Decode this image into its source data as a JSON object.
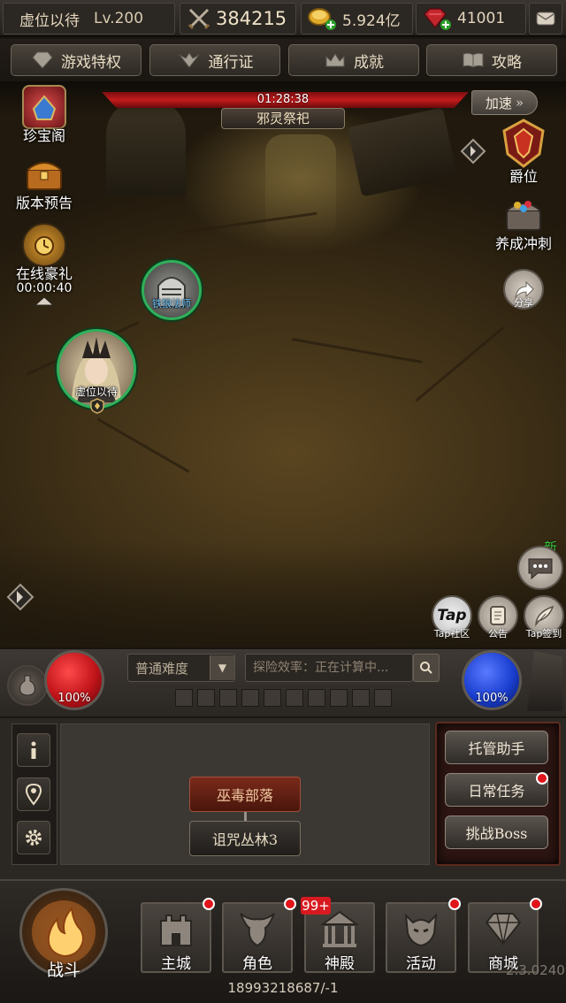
{
  "topbar": {
    "player_name": "虚位以待",
    "level": "Lv.200",
    "power": "384215",
    "gold": "5.924亿",
    "gems": "41001"
  },
  "nav": [
    "游戏特权",
    "通行证",
    "成就",
    "攻略"
  ],
  "scene": {
    "boss_timer": "01:28:38",
    "boss_title": "邪灵祭祀",
    "speed_label": "加速",
    "left_icons": [
      {
        "label": "珍宝阁"
      },
      {
        "label": "版本预告"
      },
      {
        "label": "在线豪礼",
        "timer": "00:00:40"
      }
    ],
    "right_icons": [
      {
        "label": "爵位"
      },
      {
        "label": "养成冲刺"
      }
    ],
    "share_label": "分享",
    "new_badge": "新",
    "tap_buttons": [
      {
        "glyph": "Tap",
        "label": "Tap社区"
      },
      {
        "label": "公告"
      },
      {
        "label": "Tap签到"
      }
    ],
    "pet_name": "铁狼法师",
    "player_avatar_name": "虚位以待"
  },
  "controls": {
    "hp_percent": "100%",
    "mp_percent": "100%",
    "difficulty": "普通难度",
    "map_status": "探险效率：正在计算中..."
  },
  "panel": {
    "stage_current": "巫毒部落",
    "stage_next": "诅咒丛林3",
    "right_buttons": [
      "托管助手",
      "日常任务",
      "挑战Boss"
    ]
  },
  "bottom_nav": {
    "battle": "战斗",
    "items": [
      "主城",
      "角色",
      "神殿",
      "活动",
      "商城"
    ],
    "temple_badge": "99+"
  },
  "footer": {
    "uid": "18993218687/-1",
    "version": "2.3.0240"
  },
  "colors": {
    "hp_orb": "#c0141a",
    "mp_orb": "#1a3fd0",
    "avatar_ring": "#2fb05a",
    "boss_bar": "#c21b1c"
  }
}
